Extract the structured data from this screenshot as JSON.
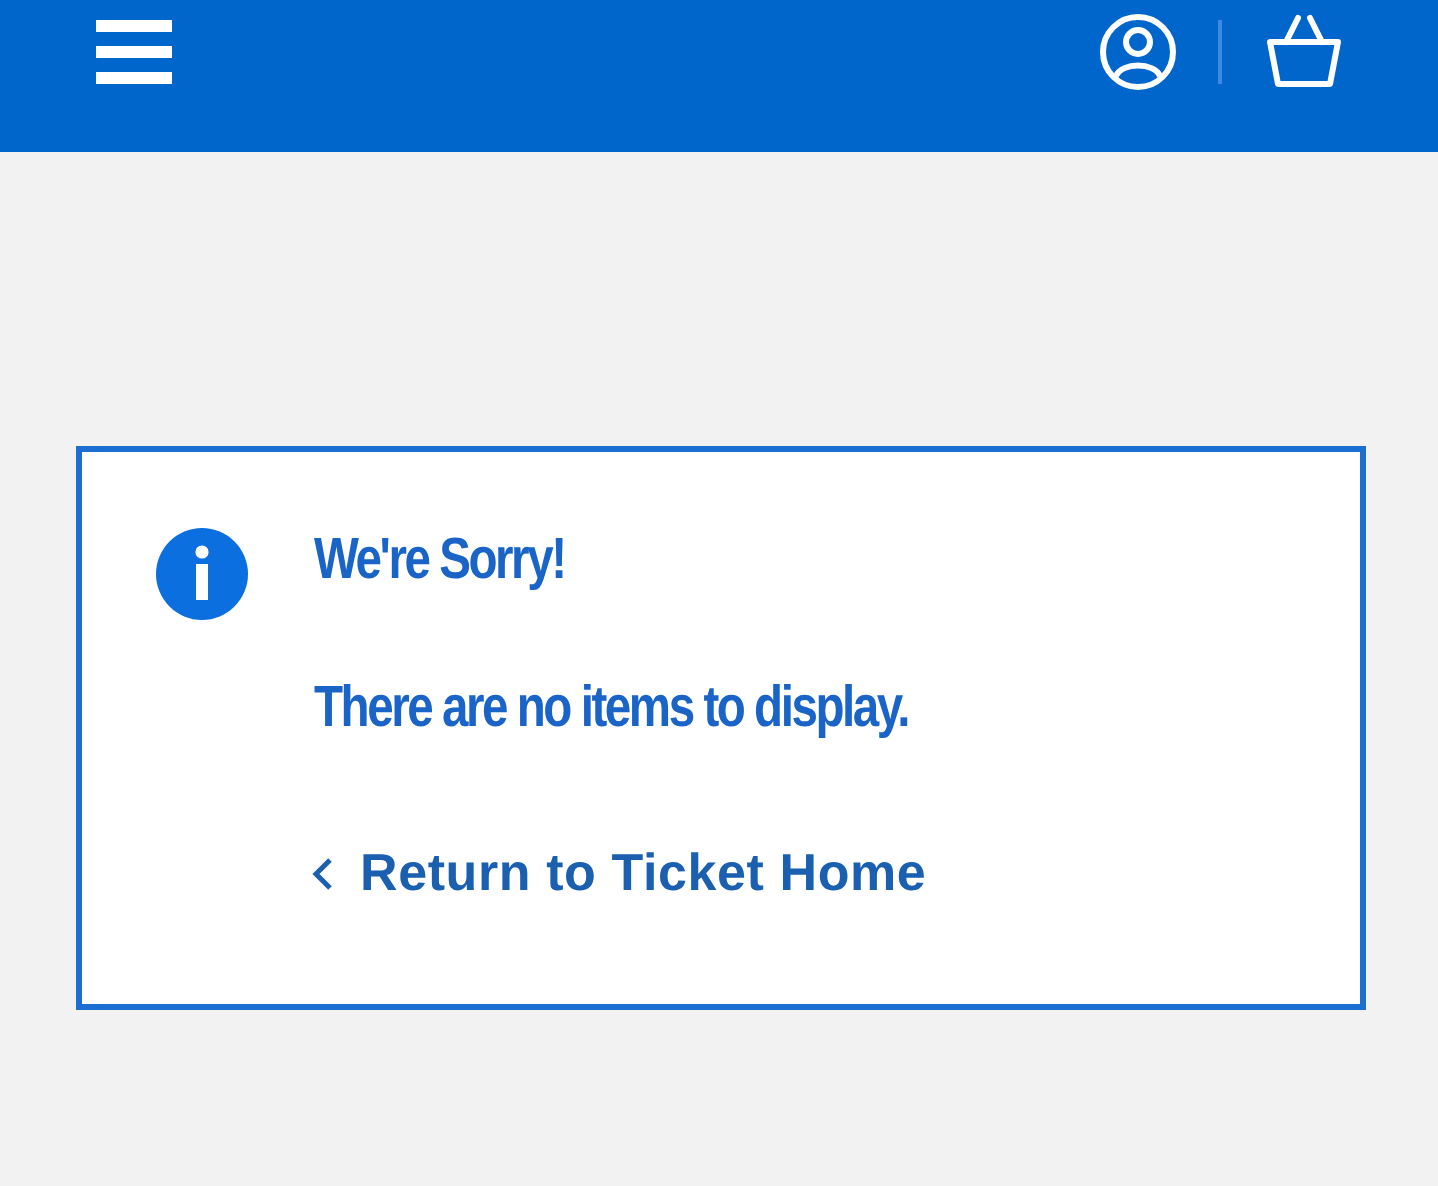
{
  "notice": {
    "title": "We're Sorry!",
    "message": "There are no items to display.",
    "link": "Return to Ticket Home"
  }
}
